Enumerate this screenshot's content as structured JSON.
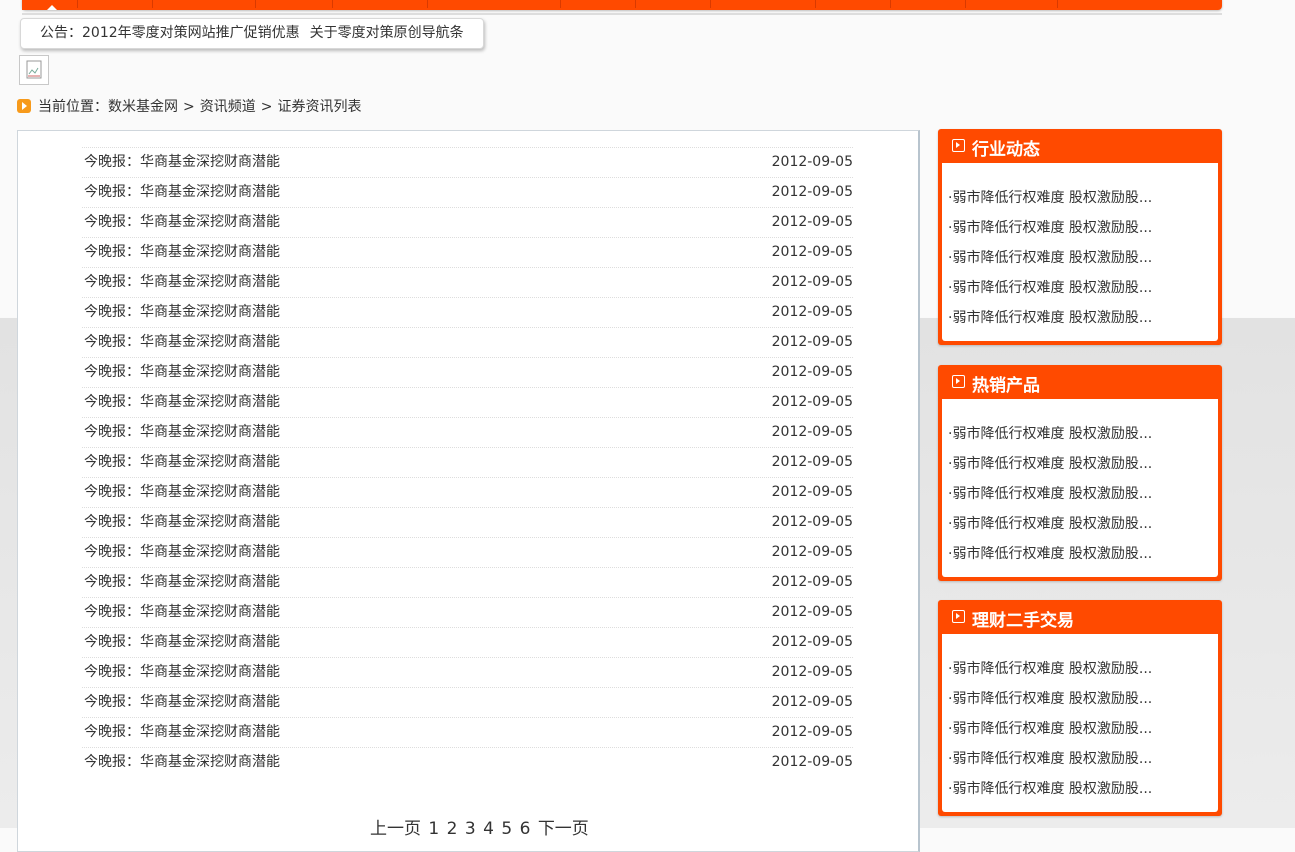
{
  "notice": {
    "label": "公告：",
    "items": [
      "2012年零度对策网站推广促销优惠",
      "关于零度对策原创导航条"
    ]
  },
  "breadcrumb": {
    "prefix": "当前位置：",
    "items": [
      "数米基金网",
      "资讯频道",
      "证券资讯列表"
    ],
    "separator": ">"
  },
  "news": [
    {
      "title": "今晚报：华商基金深挖财商潜能",
      "date": "2012-09-05"
    },
    {
      "title": "今晚报：华商基金深挖财商潜能",
      "date": "2012-09-05"
    },
    {
      "title": "今晚报：华商基金深挖财商潜能",
      "date": "2012-09-05"
    },
    {
      "title": "今晚报：华商基金深挖财商潜能",
      "date": "2012-09-05"
    },
    {
      "title": "今晚报：华商基金深挖财商潜能",
      "date": "2012-09-05"
    },
    {
      "title": "今晚报：华商基金深挖财商潜能",
      "date": "2012-09-05"
    },
    {
      "title": "今晚报：华商基金深挖财商潜能",
      "date": "2012-09-05"
    },
    {
      "title": "今晚报：华商基金深挖财商潜能",
      "date": "2012-09-05"
    },
    {
      "title": "今晚报：华商基金深挖财商潜能",
      "date": "2012-09-05"
    },
    {
      "title": "今晚报：华商基金深挖财商潜能",
      "date": "2012-09-05"
    },
    {
      "title": "今晚报：华商基金深挖财商潜能",
      "date": "2012-09-05"
    },
    {
      "title": "今晚报：华商基金深挖财商潜能",
      "date": "2012-09-05"
    },
    {
      "title": "今晚报：华商基金深挖财商潜能",
      "date": "2012-09-05"
    },
    {
      "title": "今晚报：华商基金深挖财商潜能",
      "date": "2012-09-05"
    },
    {
      "title": "今晚报：华商基金深挖财商潜能",
      "date": "2012-09-05"
    },
    {
      "title": "今晚报：华商基金深挖财商潜能",
      "date": "2012-09-05"
    },
    {
      "title": "今晚报：华商基金深挖财商潜能",
      "date": "2012-09-05"
    },
    {
      "title": "今晚报：华商基金深挖财商潜能",
      "date": "2012-09-05"
    },
    {
      "title": "今晚报：华商基金深挖财商潜能",
      "date": "2012-09-05"
    },
    {
      "title": "今晚报：华商基金深挖财商潜能",
      "date": "2012-09-05"
    },
    {
      "title": "今晚报：华商基金深挖财商潜能",
      "date": "2012-09-05"
    }
  ],
  "pager": {
    "prev": "上一页",
    "pages": [
      "1",
      "2",
      "3",
      "4",
      "5",
      "6"
    ],
    "next": "下一页"
  },
  "sidebar": [
    {
      "title": "行业动态",
      "items": [
        "·弱市降低行权难度 股权激励股...",
        "·弱市降低行权难度 股权激励股...",
        "·弱市降低行权难度 股权激励股...",
        "·弱市降低行权难度 股权激励股...",
        "·弱市降低行权难度 股权激励股..."
      ]
    },
    {
      "title": "热销产品",
      "items": [
        "·弱市降低行权难度 股权激励股...",
        "·弱市降低行权难度 股权激励股...",
        "·弱市降低行权难度 股权激励股...",
        "·弱市降低行权难度 股权激励股...",
        "·弱市降低行权难度 股权激励股..."
      ]
    },
    {
      "title": "理财二手交易",
      "items": [
        "·弱市降低行权难度 股权激励股...",
        "·弱市降低行权难度 股权激励股...",
        "·弱市降低行权难度 股权激励股...",
        "·弱市降低行权难度 股权激励股...",
        "·弱市降低行权难度 股权激励股..."
      ]
    }
  ],
  "colors": {
    "accent": "#ff4a00",
    "breadcrumb_icon": "#f79a1b"
  },
  "icons": {
    "breadcrumb": "arrow-right-icon",
    "section": "arrow-box-icon",
    "placeholder_image": "broken-image-icon"
  }
}
